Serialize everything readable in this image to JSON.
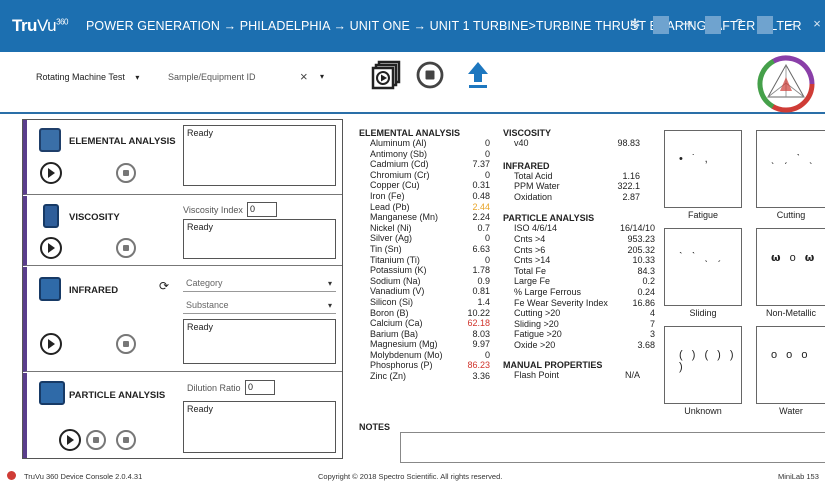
{
  "titlebar": {
    "logo_tru": "Tru",
    "logo_vu": "Vu",
    "logo_sup": "360",
    "breadcrumb": "POWER GENERATION → PHILADELPHIA → UNIT ONE → UNIT 1 TURBINE>TURBINE THRUST BEARING>AFTER FILTER",
    "icons": [
      "gear-icon",
      "logout-icon",
      "help-icon",
      "minimize-icon",
      "close-icon"
    ],
    "controls": [
      "✻",
      "⇥",
      "?",
      "–",
      "×"
    ]
  },
  "toolbar": {
    "test_type": "Rotating Machine Test",
    "sample_placeholder": "Sample/Equipment ID",
    "clear": "×",
    "dropdown": "▾"
  },
  "sections": {
    "elemental": {
      "title": "ELEMENTAL ANALYSIS",
      "status": "Ready"
    },
    "viscosity": {
      "title": "VISCOSITY",
      "field_label": "Viscosity Index",
      "field_value": "0",
      "status": "Ready"
    },
    "infrared": {
      "title": "INFRARED",
      "category_placeholder": "Category",
      "substance_placeholder": "Substance",
      "status": "Ready"
    },
    "particle": {
      "title": "PARTICLE ANALYSIS",
      "field_label": "Dilution Ratio",
      "field_value": "0",
      "status": "Ready"
    }
  },
  "elemental_analysis": {
    "header": "ELEMENTAL ANALYSIS",
    "rows": [
      {
        "label": "Aluminum (Al)",
        "value": "0",
        "color": "#222"
      },
      {
        "label": "Antimony (Sb)",
        "value": "0",
        "color": "#222"
      },
      {
        "label": "Cadmium (Cd)",
        "value": "7.37",
        "color": "#222"
      },
      {
        "label": "Chromium (Cr)",
        "value": "0",
        "color": "#222"
      },
      {
        "label": "Copper (Cu)",
        "value": "0.31",
        "color": "#222"
      },
      {
        "label": "Iron (Fe)",
        "value": "0.48",
        "color": "#222"
      },
      {
        "label": "Lead (Pb)",
        "value": "2.44",
        "color": "#e8a52a"
      },
      {
        "label": "Manganese (Mn)",
        "value": "2.24",
        "color": "#222"
      },
      {
        "label": "Nickel (Ni)",
        "value": "0.7",
        "color": "#222"
      },
      {
        "label": "Silver (Ag)",
        "value": "0",
        "color": "#222"
      },
      {
        "label": "Tin (Sn)",
        "value": "6.63",
        "color": "#222"
      },
      {
        "label": "Titanium (Ti)",
        "value": "0",
        "color": "#222"
      },
      {
        "label": "Potassium (K)",
        "value": "1.78",
        "color": "#222"
      },
      {
        "label": "Sodium (Na)",
        "value": "0.9",
        "color": "#222"
      },
      {
        "label": "Vanadium (V)",
        "value": "0.81",
        "color": "#222"
      },
      {
        "label": "Silicon (Si)",
        "value": "1.4",
        "color": "#222"
      },
      {
        "label": "Boron (B)",
        "value": "10.22",
        "color": "#222"
      },
      {
        "label": "Calcium (Ca)",
        "value": "62.18",
        "color": "#d0342c"
      },
      {
        "label": "Barium (Ba)",
        "value": "8.03",
        "color": "#222"
      },
      {
        "label": "Magnesium (Mg)",
        "value": "9.97",
        "color": "#222"
      },
      {
        "label": "Molybdenum (Mo)",
        "value": "0",
        "color": "#222"
      },
      {
        "label": "Phosphorus (P)",
        "value": "86.23",
        "color": "#d0342c"
      },
      {
        "label": "Zinc (Zn)",
        "value": "3.36",
        "color": "#222"
      }
    ]
  },
  "viscosity": {
    "header": "VISCOSITY",
    "rows": [
      {
        "label": "v40",
        "value": "98.83"
      }
    ]
  },
  "infrared": {
    "header": "INFRARED",
    "rows": [
      {
        "label": "Total Acid",
        "value": "1.16"
      },
      {
        "label": "PPM Water",
        "value": "322.1"
      },
      {
        "label": "Oxidation",
        "value": "2.87"
      }
    ]
  },
  "particle_analysis": {
    "header": "PARTICLE ANALYSIS",
    "rows": [
      {
        "label": "ISO 4/6/14",
        "value": "16/14/10"
      },
      {
        "label": "Cnts >4",
        "value": "953.23"
      },
      {
        "label": "Cnts >6",
        "value": "205.32"
      },
      {
        "label": "Cnts >14",
        "value": "10.33"
      },
      {
        "label": "Total Fe",
        "value": "84.3"
      },
      {
        "label": "Large Fe",
        "value": "0.2"
      },
      {
        "label": "% Large Ferrous",
        "value": "0.24"
      },
      {
        "label": "Fe Wear Severity Index",
        "value": "16.86"
      },
      {
        "label": "Cutting >20",
        "value": "4"
      },
      {
        "label": "Sliding >20",
        "value": "7"
      },
      {
        "label": "Fatigue >20",
        "value": "3"
      },
      {
        "label": "Oxide >20",
        "value": "3.68"
      }
    ]
  },
  "manual_properties": {
    "header": "MANUAL PROPERTIES",
    "rows": [
      {
        "label": "Flash Point",
        "value": "N/A"
      }
    ]
  },
  "notes": {
    "header": "NOTES"
  },
  "wear_cards": [
    "Fatigue",
    "Cutting",
    "Sliding",
    "Non-Metallic",
    "Unknown",
    "Water"
  ],
  "footer": {
    "version": "TruVu 360 Device Console 2.0.4.31",
    "copyright": "Copyright © 2018 Spectro Scientific. All rights reserved.",
    "device": "MiniLab 153"
  }
}
